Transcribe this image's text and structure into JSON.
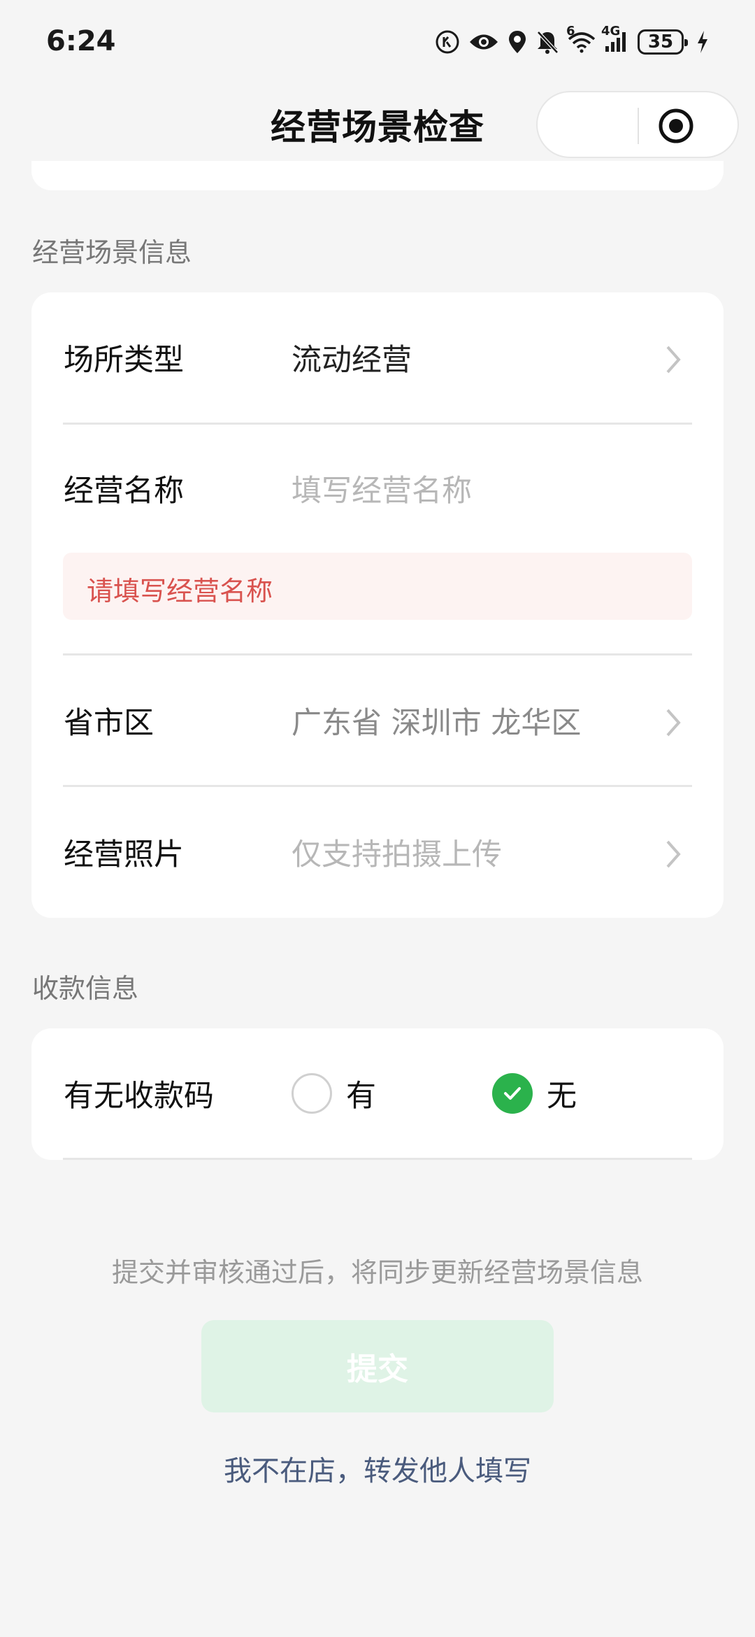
{
  "status_bar": {
    "time": "6:24",
    "network_label": "4G",
    "wifi_label": "6",
    "battery_level": "35",
    "icons": [
      "hd-call-icon",
      "eye-icon",
      "location-icon",
      "mute-bell-icon",
      "wifi-icon",
      "signal-icon",
      "battery-icon",
      "charging-icon"
    ]
  },
  "nav": {
    "title": "经营场景检查",
    "capsule_icons": [
      "more-dots-icon",
      "close-target-icon"
    ]
  },
  "business_scene": {
    "section_title": "经营场景信息",
    "venue_type": {
      "label": "场所类型",
      "value": "流动经营"
    },
    "business_name": {
      "label": "经营名称",
      "placeholder": "填写经营名称",
      "error": "请填写经营名称"
    },
    "region": {
      "label": "省市区",
      "value": "广东省 深圳市 龙华区"
    },
    "photo": {
      "label": "经营照片",
      "placeholder": "仅支持拍摄上传"
    }
  },
  "payment": {
    "section_title": "收款信息",
    "has_qr": {
      "label": "有无收款码",
      "options": [
        "有",
        "无"
      ],
      "selected": "无"
    }
  },
  "footer": {
    "hint": "提交并审核通过后，将同步更新经营场景信息",
    "submit_label": "提交",
    "forward_link": "我不在店，转发他人填写"
  },
  "colors": {
    "accent_green": "#2bb24c",
    "disabled_button": "#dff3e6",
    "error_text": "#d9534f",
    "error_background": "#fdf3f2",
    "link": "#4a5b7d",
    "background": "#f5f5f5"
  }
}
